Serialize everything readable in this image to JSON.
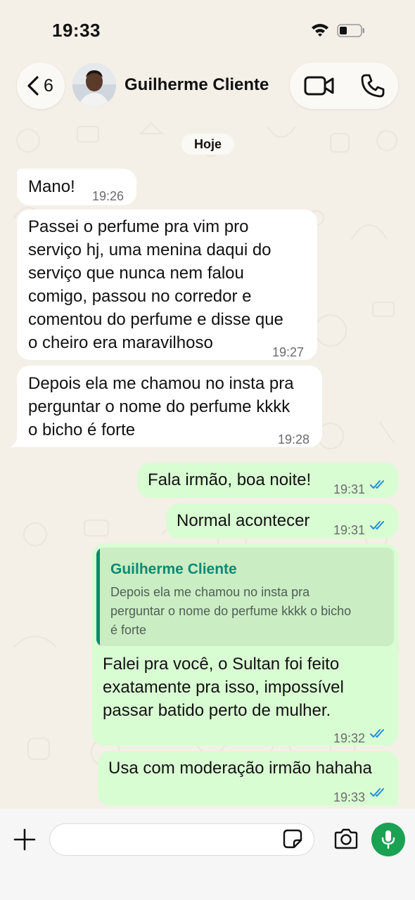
{
  "status_bar": {
    "time": "19:33"
  },
  "header": {
    "back_count": "6",
    "contact_name": "Guilherme Cliente"
  },
  "date_chip": "Hoje",
  "messages": [
    {
      "direction": "incoming",
      "text": "Mano!",
      "time": "19:26"
    },
    {
      "direction": "incoming",
      "lines": [
        "Passei o perfume pra vim pro",
        "serviço hj, uma menina daqui do",
        "serviço que nunca nem falou",
        "comigo, passou no corredor e",
        "comentou do perfume e disse que",
        "o cheiro era maravilhoso"
      ],
      "time": "19:27"
    },
    {
      "direction": "incoming",
      "lines": [
        "Depois ela me chamou no insta pra",
        "perguntar o nome do perfume kkkk",
        "o bicho é forte"
      ],
      "time": "19:28"
    },
    {
      "direction": "outgoing",
      "text": "Fala irmão, boa noite!",
      "time": "19:31",
      "status": "read"
    },
    {
      "direction": "outgoing",
      "text": "Normal acontecer",
      "time": "19:31",
      "status": "read"
    },
    {
      "direction": "outgoing",
      "quote": {
        "author": "Guilherme Cliente",
        "lines": [
          "Depois ela me chamou no insta pra",
          "perguntar o nome do perfume kkkk o bicho",
          "é forte"
        ]
      },
      "lines": [
        "Falei pra você, o Sultan foi feito",
        "exatamente pra isso, impossível",
        "passar batido perto de mulher."
      ],
      "time": "19:32",
      "status": "read"
    },
    {
      "direction": "outgoing",
      "text": "Usa com moderação irmão hahaha",
      "time": "19:33",
      "status": "read"
    }
  ],
  "composer": {
    "placeholder": ""
  },
  "icons": {
    "back": "chevron-left-icon",
    "video": "video-camera-icon",
    "phone": "phone-icon",
    "plus": "plus-icon",
    "sticker": "sticker-icon",
    "camera": "camera-icon",
    "mic": "microphone-icon"
  },
  "colors": {
    "background": "#f4efe7",
    "incoming_bubble": "#ffffff",
    "outgoing_bubble": "#d9fdd3",
    "read_ticks": "#1f8fd6",
    "quote_accent": "#078b73",
    "mic_button": "#1aa152"
  }
}
